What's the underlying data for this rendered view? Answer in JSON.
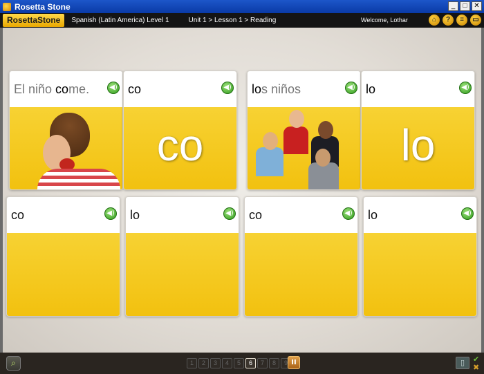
{
  "window": {
    "title": "Rosetta Stone",
    "buttons": [
      "_",
      "□",
      "✕"
    ]
  },
  "header": {
    "logo": "RosettaStone",
    "course": "Spanish (Latin America) Level 1",
    "breadcrumb": "Unit 1 > Lesson 1 > Reading",
    "welcome": "Welcome, Lothar",
    "icons": [
      "home-icon",
      "help-icon",
      "menu-icon",
      "chat-icon"
    ]
  },
  "cards_top": [
    {
      "pre": "El niño ",
      "hl": "co",
      "post": "me.",
      "kind": "photo-boy"
    },
    {
      "pre": "",
      "hl": "co",
      "post": "",
      "big": "co"
    },
    {
      "pre": "",
      "hl": "lo",
      "post": "s niños",
      "kind": "photo-kids"
    },
    {
      "pre": "",
      "hl": "lo",
      "post": "",
      "big": "lo"
    }
  ],
  "cards_bottom": [
    {
      "label": "co"
    },
    {
      "label": "lo"
    },
    {
      "label": "co"
    },
    {
      "label": "lo"
    }
  ],
  "footer": {
    "pages": [
      "1",
      "2",
      "3",
      "4",
      "5",
      "6",
      "7",
      "8",
      "9"
    ],
    "current_page": "6",
    "pause_label": "II"
  }
}
